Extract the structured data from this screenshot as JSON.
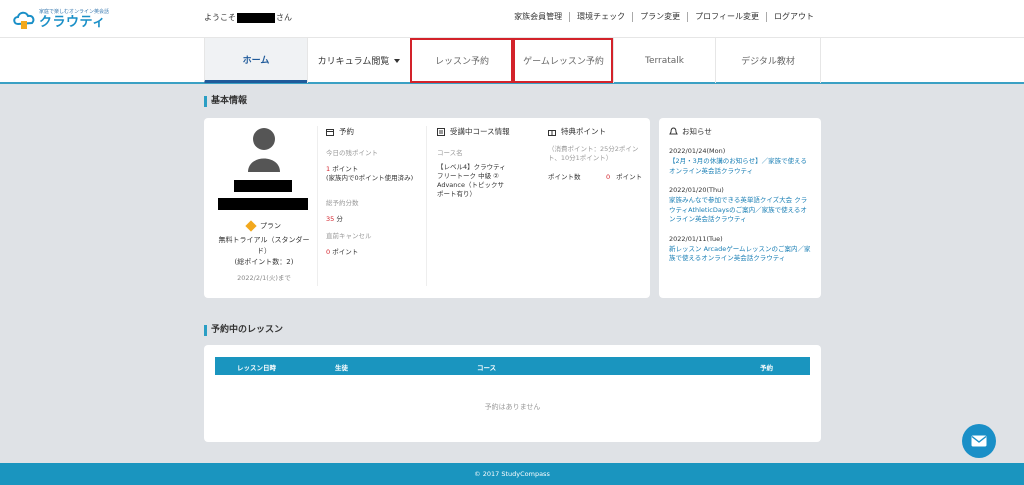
{
  "brand": {
    "tagline": "家庭で楽しむオンライン英会話",
    "name": "クラウティ"
  },
  "header": {
    "welcome_prefix": "ようこそ",
    "welcome_suffix": "さん",
    "links": [
      "家族会員管理",
      "環境チェック",
      "プラン変更",
      "プロフィール変更",
      "ログアウト"
    ]
  },
  "tabs": [
    "ホーム",
    "カリキュラム閲覧",
    "レッスン予約",
    "ゲームレッスン予約",
    "Terratalk",
    "デジタル教材"
  ],
  "basic_info": {
    "title": "基本情報",
    "plan_label": "プラン",
    "plan_desc": "無料トライアル（スタンダード）",
    "plan_points": "(総ポイント数：2)",
    "plan_expiry": "2022/2/1(火)まで",
    "reservation": {
      "heading": "予約",
      "today_label": "今日の残ポイント",
      "today_value": "1",
      "today_unit": "ポイント",
      "today_note": "(家族内で0ポイント使用済み)",
      "total_label": "総予約分数",
      "total_value": "35",
      "total_unit": "分",
      "cancel_label": "直前キャンセル",
      "cancel_value": "0",
      "cancel_unit": "ポイント"
    },
    "course": {
      "heading": "受講中コース情報",
      "name_label": "コース名",
      "name_value": "【レベル4】クラウティ フリートーク 中級 ② Advance（トピックサポート有り）"
    },
    "special": {
      "heading": "特典ポイント",
      "note": "（消費ポイント：25分2ポイント、10分1ポイント）",
      "points_label": "ポイント数",
      "points_value": "0",
      "points_unit": "ポイント"
    }
  },
  "news": {
    "heading": "お知らせ",
    "items": [
      {
        "date": "2022/01/24(Mon)",
        "text": "【2月・3月の休講のお知らせ】／家族で使えるオンライン英会話クラウティ"
      },
      {
        "date": "2022/01/20(Thu)",
        "text": "家族みんなで参加できる英単語クイズ大会 クラウティAthleticDaysのご案内／家族で使えるオンライン英会話クラウティ"
      },
      {
        "date": "2022/01/11(Tue)",
        "text": "新レッスン Arcadeゲームレッスンのご案内／家族で使えるオンライン英会話クラウティ"
      }
    ]
  },
  "upcoming": {
    "title": "予約中のレッスン",
    "columns": [
      "レッスン日時",
      "生徒",
      "コース",
      "予約"
    ],
    "empty": "予約はありません"
  },
  "footer": "© 2017 StudyCompass",
  "colors": {
    "accent": "#1a95bf",
    "highlight": "#d3222a",
    "red": "#d3222a"
  }
}
